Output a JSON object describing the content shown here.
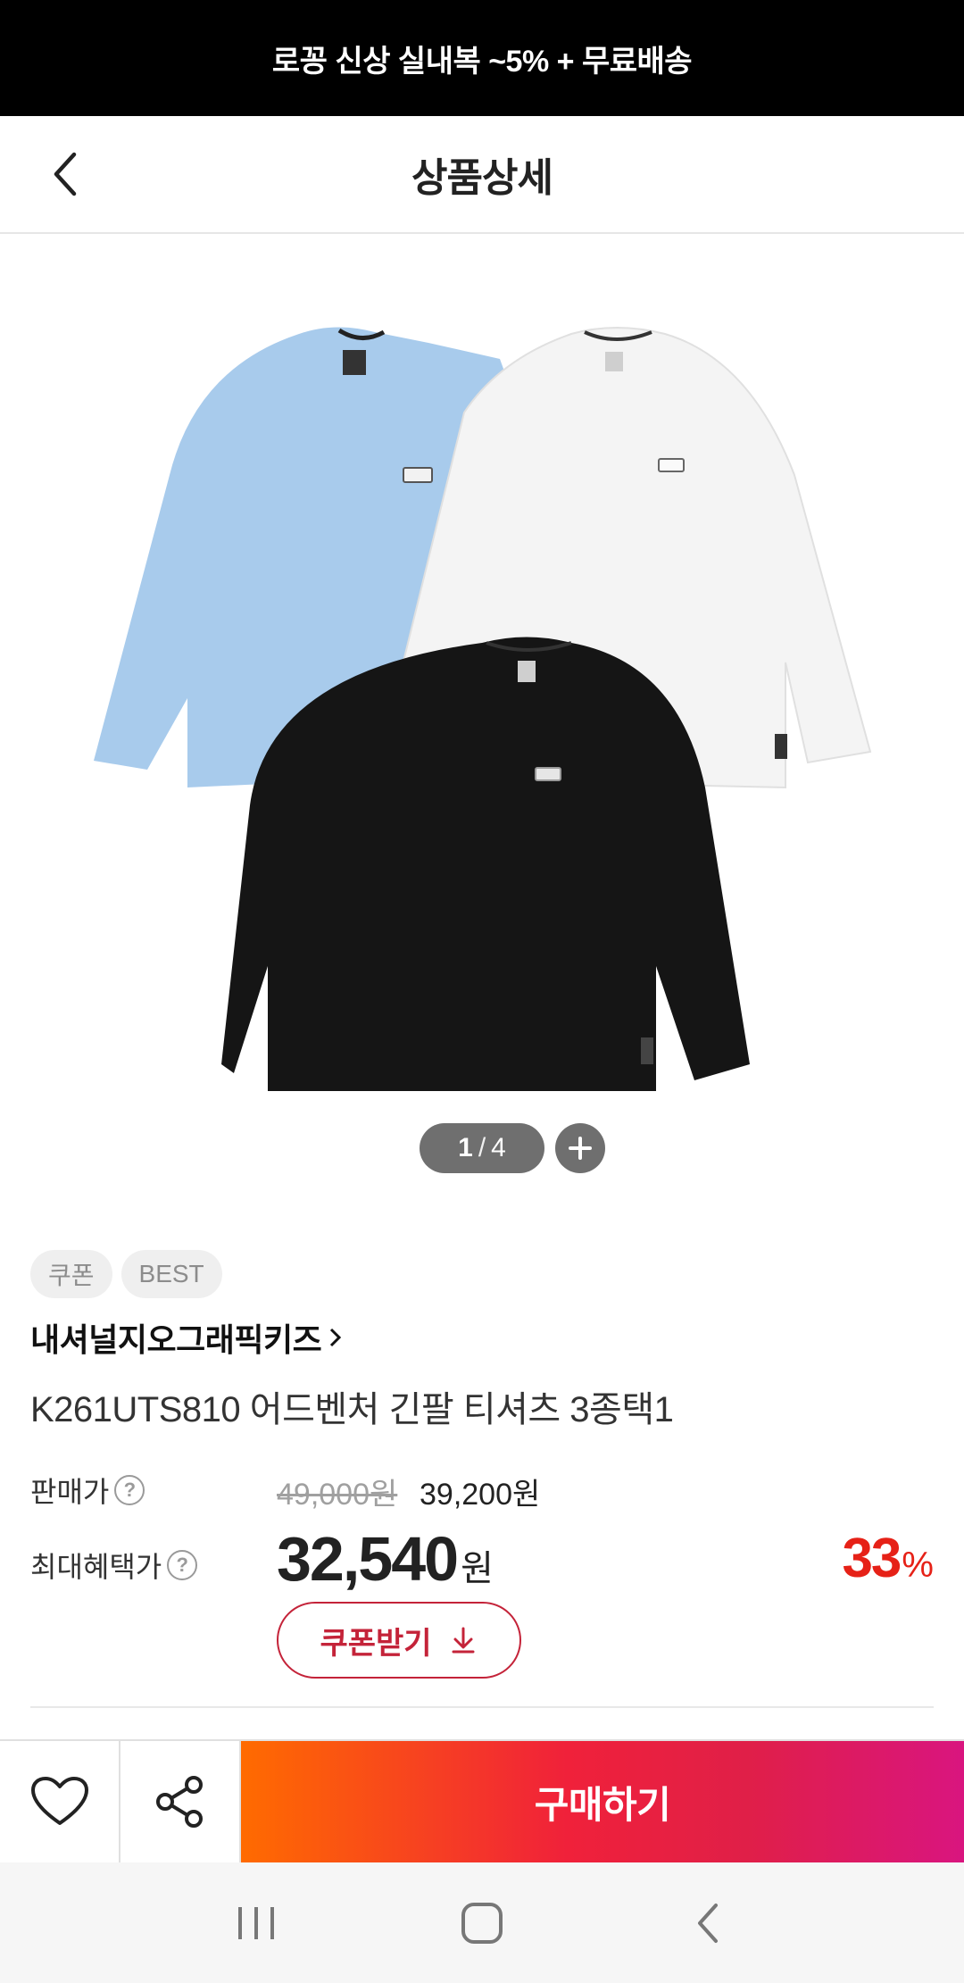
{
  "promo_banner": {
    "text": "로꽁 신상 실내복 ~5% + 무료배송"
  },
  "header": {
    "title": "상품상세",
    "back_icon": "chevron-left-icon"
  },
  "gallery": {
    "current": "1",
    "separator": "/",
    "total": "4",
    "zoom_icon": "plus-icon",
    "colors": {
      "blue": "#a8cbec",
      "white": "#f4f4f4",
      "black": "#151515"
    }
  },
  "badges": [
    "쿠폰",
    "BEST"
  ],
  "product": {
    "brand": "내셔널지오그래픽키즈",
    "name": "K261UTS810 어드벤처 긴팔 티셔츠 3종택1"
  },
  "pricing": {
    "sale_label": "판매가",
    "original_price": "49,000원",
    "sale_price": "39,200원",
    "max_label": "최대혜택가",
    "max_price": "32,540",
    "max_currency": "원",
    "discount": "33",
    "discount_unit": "%",
    "help_icon": "question-circle-icon"
  },
  "coupon_button": {
    "label": "쿠폰받기",
    "icon": "download-arrow-icon",
    "color": "#c42339"
  },
  "bottom_bar": {
    "like_icon": "heart-icon",
    "share_icon": "share-icon",
    "buy_label": "구매하기"
  },
  "system_nav": {
    "recents_icon": "recents-icon",
    "home_icon": "home-icon",
    "back_icon": "back-icon"
  }
}
